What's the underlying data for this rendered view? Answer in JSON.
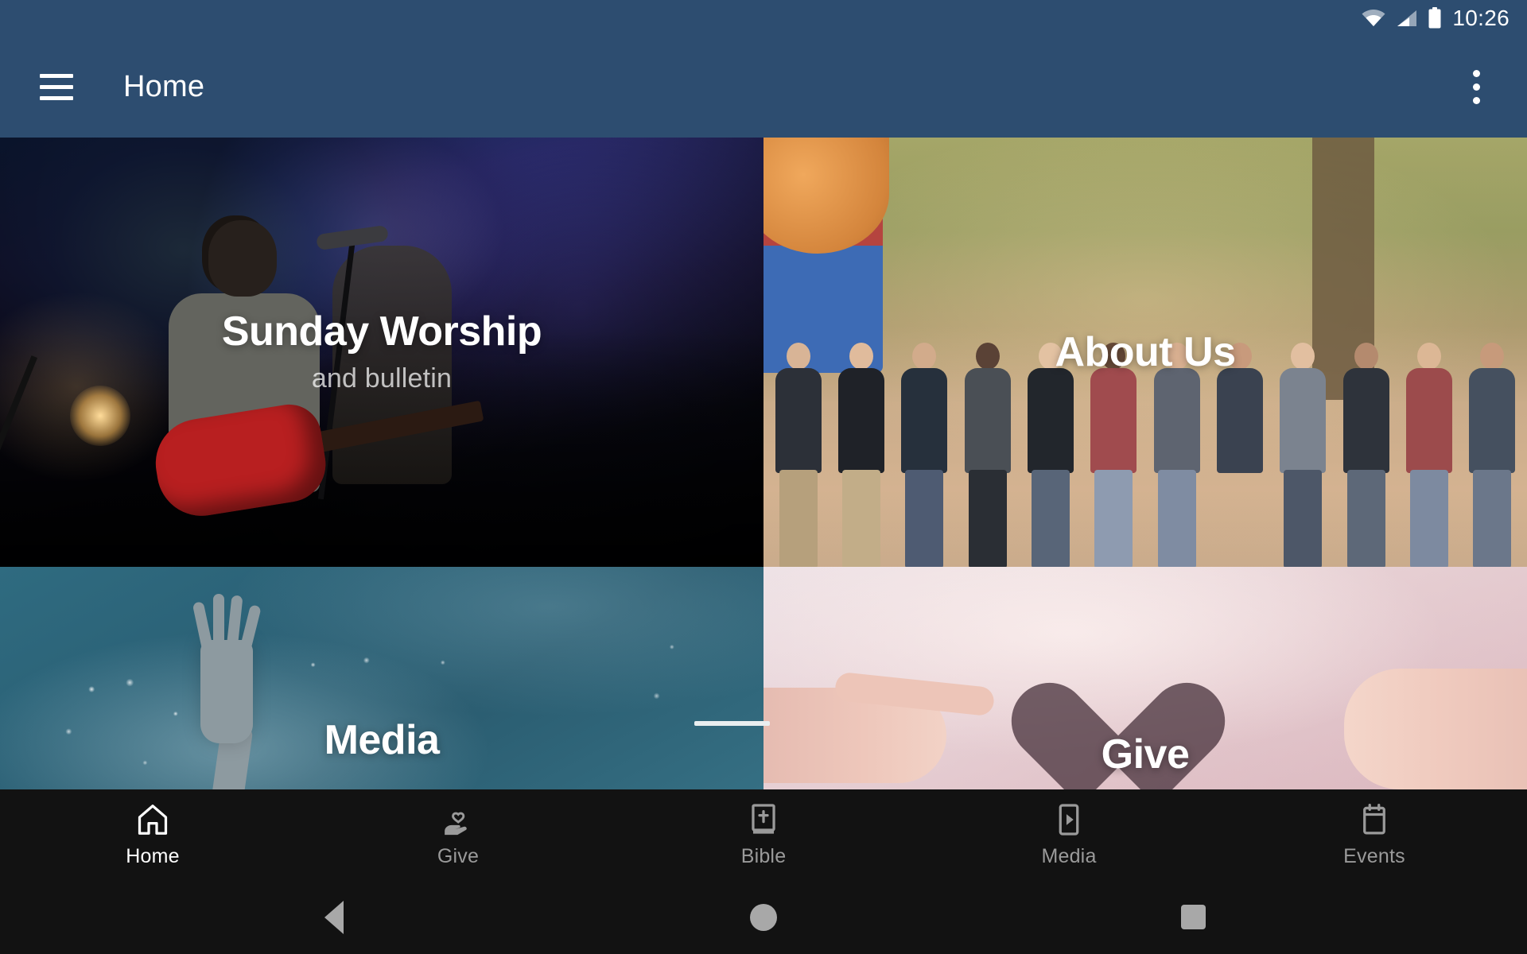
{
  "status_bar": {
    "time": "10:26",
    "icons": [
      "wifi-icon",
      "cellular-signal-icon",
      "battery-icon"
    ]
  },
  "app_bar": {
    "menu_icon": "hamburger-menu-icon",
    "title": "Home",
    "overflow_icon": "more-vertical-icon"
  },
  "tiles": [
    {
      "id": "sunday-worship",
      "title": "Sunday Worship",
      "subtitle": "and bulletin",
      "image_description": "worship band on stage with blue lighting",
      "accent": "#2a56b8"
    },
    {
      "id": "about-us",
      "title": "About Us",
      "subtitle": "",
      "image_description": "group of people outdoors linking arms",
      "accent": "#c7ab8b"
    },
    {
      "id": "media",
      "title": "Media",
      "subtitle": "",
      "image_description": "raised hand in teal smoke",
      "accent": "#2f6b80"
    },
    {
      "id": "give",
      "title": "Give",
      "subtitle": "",
      "image_description": "hands holding a paper heart",
      "accent": "#e0c4c9"
    }
  ],
  "tab_bar": {
    "items": [
      {
        "label": "Home",
        "icon": "home-icon",
        "active": true
      },
      {
        "label": "Give",
        "icon": "give-heart-hand-icon",
        "active": false
      },
      {
        "label": "Bible",
        "icon": "bible-book-icon",
        "active": false
      },
      {
        "label": "Media",
        "icon": "media-play-icon",
        "active": false
      },
      {
        "label": "Events",
        "icon": "calendar-icon",
        "active": false
      }
    ],
    "active_color": "#ffffff",
    "inactive_color": "#9a9a9a",
    "background": "#121212"
  },
  "system_nav": {
    "back": "back-triangle-icon",
    "home": "home-circle-icon",
    "recents": "recents-square-icon"
  },
  "theme": {
    "app_bar_color": "#2d4d70",
    "status_bar_color": "#2d4d70",
    "nav_background": "#121212"
  }
}
